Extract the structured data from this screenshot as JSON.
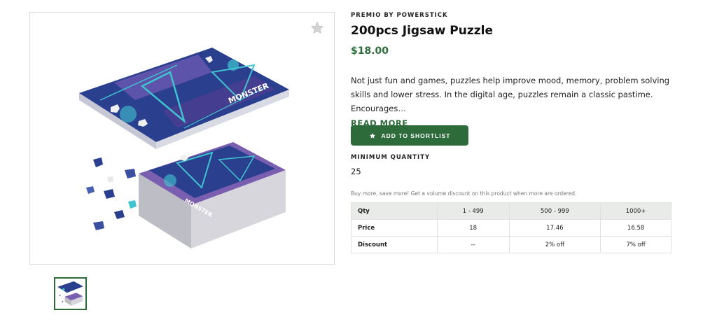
{
  "product": {
    "brand": "PREMIO BY POWERSTICK",
    "title": "200pcs Jigsaw Puzzle",
    "price": "$18.00",
    "description": "Not just fun and games, puzzles help improve mood, memory, problem solving skills and lower stress. In the digital age, puzzles remain a classic pastime. Encourages…",
    "read_more": "READ MORE",
    "image_icon": "puzzle-product-image",
    "puzzle_brand_text": "MONSTER"
  },
  "actions": {
    "shortlist_label": "ADD TO SHORTLIST",
    "shortlist_icon": "star-icon",
    "favorite_icon": "star-icon"
  },
  "min_quantity": {
    "label": "MINIMUM QUANTITY",
    "value": "25"
  },
  "volume": {
    "note": "Buy more, save more! Get a volume discount on this product when more are ordered.",
    "headers": [
      "Qty",
      "1 - 499",
      "500 - 999",
      "1000+"
    ],
    "rows": [
      [
        "Price",
        "18",
        "17.46",
        "16.58"
      ],
      [
        "Discount",
        "--",
        "2% off",
        "7% off"
      ]
    ]
  },
  "colors": {
    "accent": "#2e6b3a",
    "puzzle_blue": "#2b3f8f",
    "puzzle_teal": "#3fc4cf",
    "puzzle_purple": "#7a5fb0"
  }
}
